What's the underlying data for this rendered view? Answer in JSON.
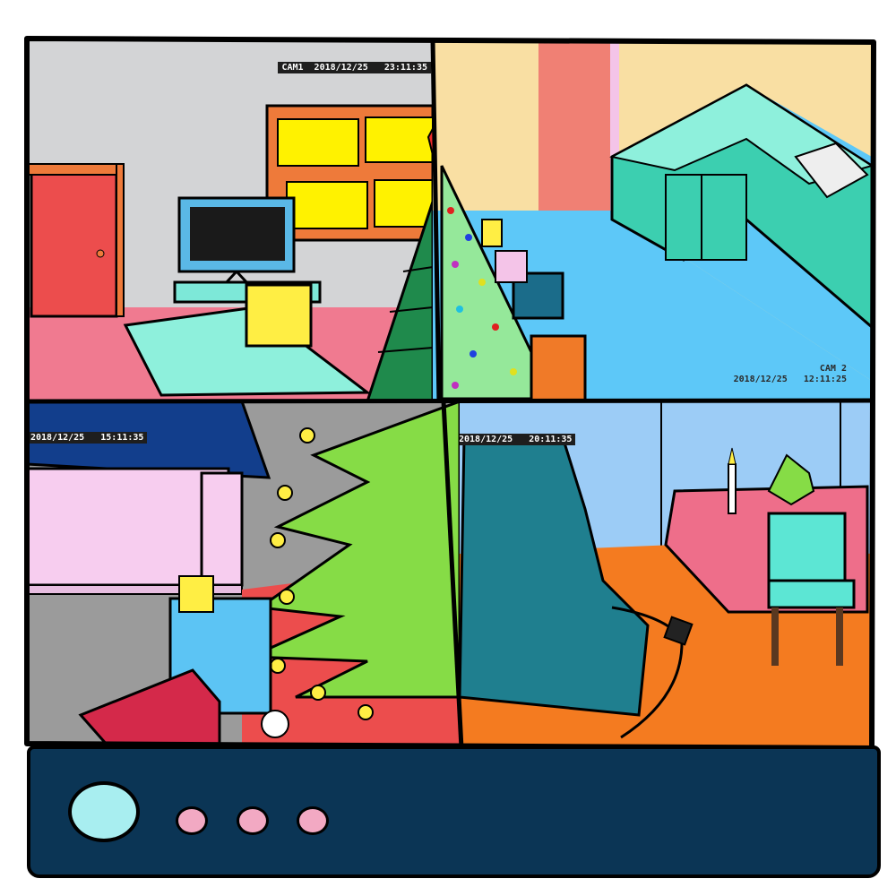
{
  "cameras": [
    {
      "id": "cam1",
      "overlay": "CAM1  2018/12/25   23:11:35"
    },
    {
      "id": "cam2",
      "label": "CAM 2",
      "datetime": "2018/12/25   12:11:25"
    },
    {
      "id": "cam3",
      "overlay": "2018/12/25   15:11:35"
    },
    {
      "id": "cam4",
      "overlay": "2018/12/25   20:11:35"
    }
  ],
  "panel": {
    "power_button": "power-button",
    "buttons": [
      "button-1",
      "button-2",
      "button-3"
    ]
  },
  "colors": {
    "frame": "#000000",
    "panel": "#0b3555",
    "power": "#a8eef0",
    "buttons": "#f2a9c3"
  }
}
